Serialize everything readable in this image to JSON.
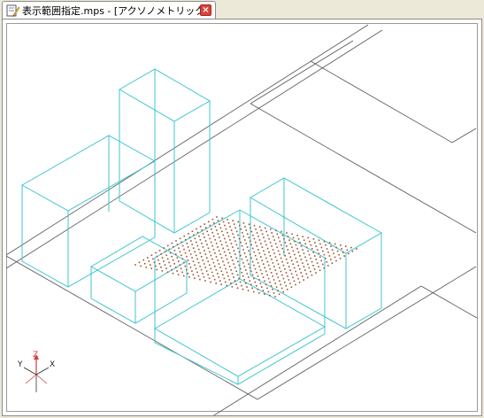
{
  "tab": {
    "title": "表示範囲指定.mps - [アクソノメトリック]",
    "close_symbol": "×"
  },
  "icons": {
    "document": "document-edit-icon",
    "close": "close-icon"
  },
  "axis_gizmo": {
    "x_label": "X",
    "y_label": "Y",
    "z_label": "Z"
  },
  "colors": {
    "building_wire": "#3fc6d0",
    "ground_lines": "#555555",
    "dots": "#a0522d",
    "axis_z": "#d23c3c",
    "tab_close": "#d9453a"
  }
}
